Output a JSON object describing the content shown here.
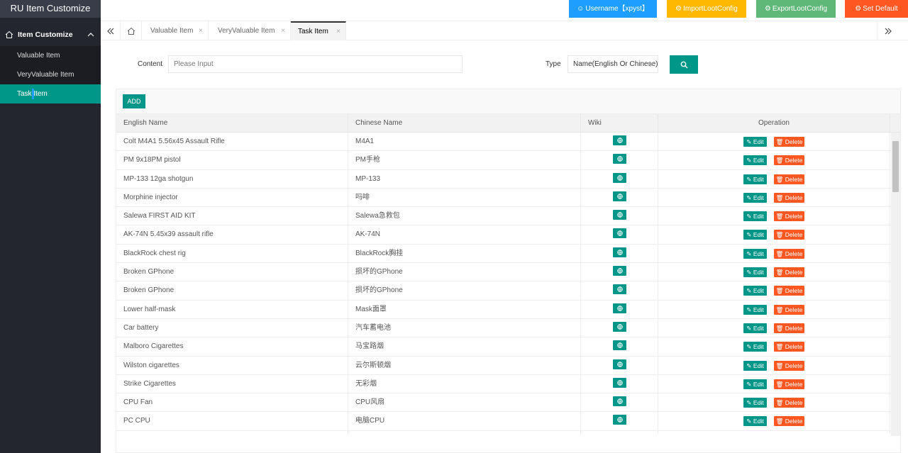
{
  "app": {
    "title": "RU Item Customize"
  },
  "sidebar": {
    "group_label": "Item Customize",
    "items": [
      {
        "label": "Valuable Item",
        "active": false
      },
      {
        "label": "VeryValuable Item",
        "active": false
      },
      {
        "label": "Task Item",
        "active": true
      }
    ]
  },
  "topbar": {
    "username": "Username【xpyst】",
    "import": "ImportLootConfig",
    "export": "ExportLootConfig",
    "default": "Set Default",
    "colors": {
      "username": "#1e9fff",
      "import": "#ffb800",
      "export": "#5fb878",
      "default": "#ff5722"
    }
  },
  "tabs": [
    {
      "label": "Valuable Item",
      "close": "×"
    },
    {
      "label": "VeryValuable Item",
      "close": "×"
    },
    {
      "label": "Task Item",
      "close": "×"
    }
  ],
  "search": {
    "content_label": "Content",
    "content_placeholder": "Please Input",
    "type_label": "Type",
    "type_value": "Name(English Or Chinese)"
  },
  "table": {
    "add_label": "ADD",
    "headers": {
      "english": "English Name",
      "chinese": "Chinese Name",
      "wiki": "Wiki",
      "operation": "Operation"
    },
    "edit_label": "Edit",
    "delete_label": "Delete",
    "rows": [
      {
        "en": "Colt M4A1 5.56x45 Assault Rifle",
        "cn": "M4A1"
      },
      {
        "en": "PM 9x18PM pistol",
        "cn": "PM手枪"
      },
      {
        "en": "MP-133 12ga shotgun",
        "cn": "MP-133"
      },
      {
        "en": "Morphine injector",
        "cn": "吗啡"
      },
      {
        "en": "Salewa FIRST AID KIT",
        "cn": "Salewa急救包"
      },
      {
        "en": "AK-74N 5.45x39 assault rifle",
        "cn": "AK-74N"
      },
      {
        "en": "BlackRock chest rig",
        "cn": "BlackRock胸挂"
      },
      {
        "en": "Broken GPhone",
        "cn": "损坏的GPhone"
      },
      {
        "en": "Broken GPhone",
        "cn": "损坏的GPhone"
      },
      {
        "en": "Lower half-mask",
        "cn": "Mask面罩"
      },
      {
        "en": "Car battery",
        "cn": "汽车蓄电池"
      },
      {
        "en": "Malboro Cigarettes",
        "cn": "马宝路烟"
      },
      {
        "en": "Wilston cigarettes",
        "cn": "云尔斯顿烟"
      },
      {
        "en": "Strike Cigarettes",
        "cn": "无彩烟"
      },
      {
        "en": "CPU Fan",
        "cn": "CPU风扇"
      },
      {
        "en": "PC CPU",
        "cn": "电脑CPU"
      },
      {
        "en": "",
        "cn": ""
      }
    ]
  },
  "accent": "#009688"
}
